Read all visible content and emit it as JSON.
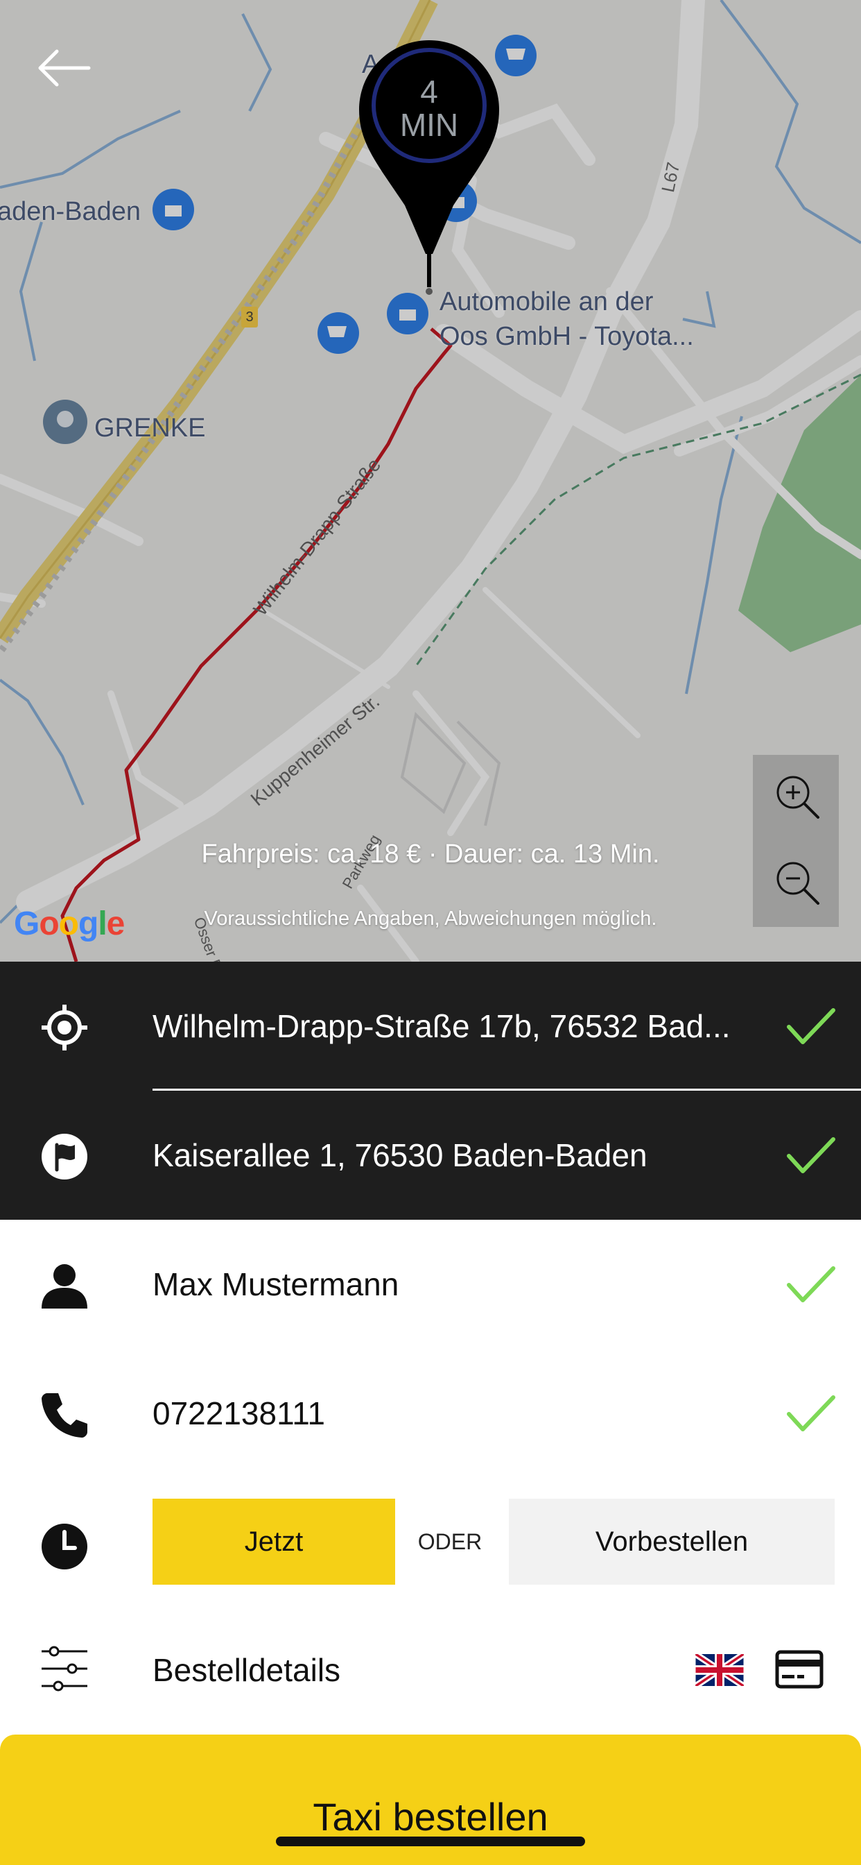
{
  "map": {
    "labels": {
      "place_baden": "aden-Baden",
      "place_grenke": "GRENKE",
      "place_automobile_line1": "Automobile an der",
      "place_automobile_line2": "Oos GmbH - Toyota...",
      "place_a": "A",
      "road_wilhelm": "Wilhelm-Drapp-Straße",
      "road_kuppenheimer": "Kuppenheimer Str.",
      "road_parkweg": "Parkweg",
      "road_osser": "Osser Bl",
      "road_l67": "L67",
      "route_badge": "3"
    },
    "pin": {
      "number": "4",
      "unit": "MIN"
    },
    "fare_text": "Fahrpreis: ca. 18 € · Dauer: ca. 13 Min.",
    "disclaimer_text": "Voraussichtliche Angaben, Abweichungen möglich.",
    "attribution": "Google",
    "zoom_in_icon": "zoom-in-icon",
    "zoom_out_icon": "zoom-out-icon",
    "back_icon": "arrow-left-icon"
  },
  "form": {
    "pickup": {
      "icon": "target-location-icon",
      "value": "Wilhelm-Drapp-Straße 17b, 76532 Bad..."
    },
    "destination": {
      "icon": "flag-icon",
      "value": "Kaiserallee 1, 76530 Baden-Baden"
    },
    "name": {
      "icon": "person-icon",
      "value": "Max Mustermann"
    },
    "phone": {
      "icon": "phone-icon",
      "value": "0722138111"
    },
    "time": {
      "icon": "clock-icon",
      "now_label": "Jetzt",
      "or_label": "ODER",
      "preorder_label": "Vorbestellen"
    },
    "details": {
      "icon": "sliders-icon",
      "label": "Bestelldetails",
      "language_icon": "uk-flag-icon",
      "payment_icon": "credit-card-icon"
    }
  },
  "order_button_label": "Taxi bestellen",
  "colors": {
    "accent_yellow": "#f5d016",
    "dark_panel": "#1e1e1e",
    "check_green": "#7ed957",
    "route_red": "#c0000c"
  }
}
